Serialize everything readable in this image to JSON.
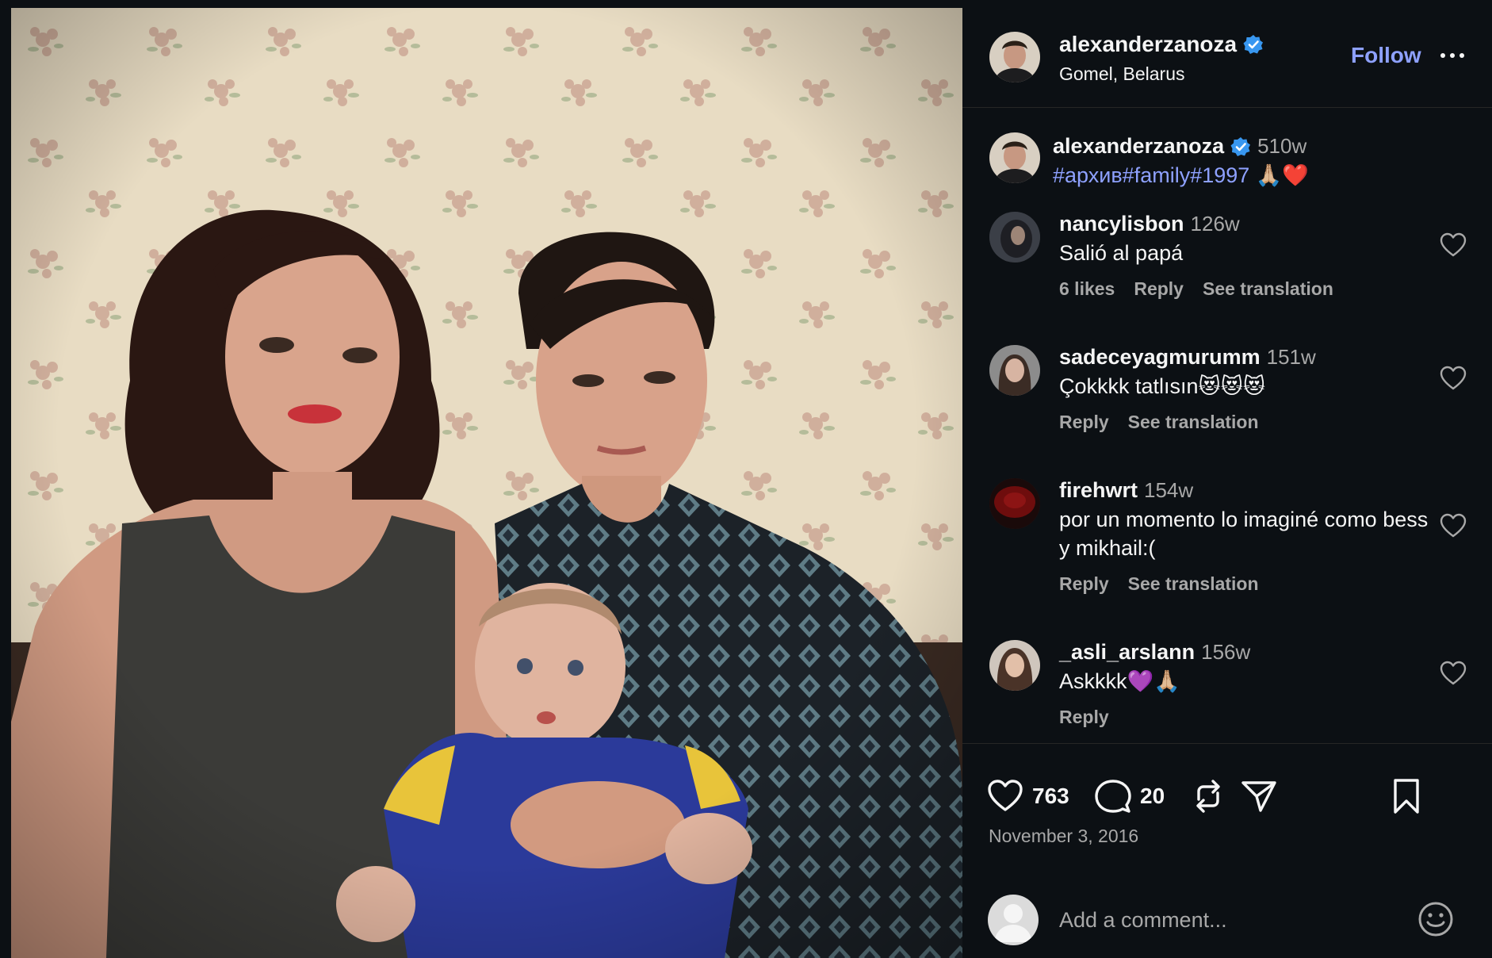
{
  "post": {
    "username": "alexanderzanoza",
    "location": "Gomel, Belarus",
    "follow_label": "Follow"
  },
  "caption": {
    "username": "alexanderzanoza",
    "age": "510w",
    "tags": "#архив#family#1997",
    "emoji": "🙏🏼❤️"
  },
  "comments": [
    {
      "username": "nancylisbon",
      "age": "126w",
      "text": "Salió al papá",
      "likes": "6 likes",
      "reply": "Reply",
      "translate": "See translation"
    },
    {
      "username": "sadeceyagmurumm",
      "age": "151w",
      "text": "Çokkkk tatlısın😻😻😻",
      "reply": "Reply",
      "translate": "See translation"
    },
    {
      "username": "firehwrt",
      "age": "154w",
      "text": "por un momento lo imaginé como bess y mikhail:(",
      "reply": "Reply",
      "translate": "See translation"
    },
    {
      "username": "_asli_arslann",
      "age": "156w",
      "text": "Askkkk💜🙏🏼",
      "reply": "Reply"
    }
  ],
  "actions": {
    "like_count": "763",
    "comment_count": "20"
  },
  "date": "November 3, 2016",
  "add_comment": {
    "placeholder": "Add a comment..."
  },
  "colors": {
    "background": "#0c1014",
    "link_blue": "#8ea1ff",
    "secondary_text": "#a8a8a8",
    "verified_blue": "#3897f0"
  },
  "icons": [
    "verified-badge-icon",
    "more-options-icon",
    "heart-icon",
    "comment-icon",
    "repost-icon",
    "share-icon",
    "bookmark-icon",
    "emoji-icon",
    "default-avatar-icon"
  ]
}
